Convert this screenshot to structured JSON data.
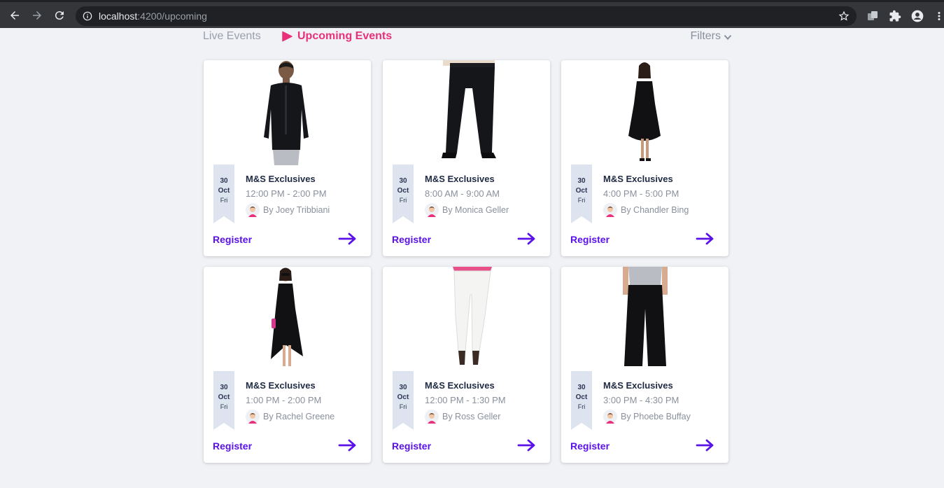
{
  "browser": {
    "url_host": "localhost",
    "url_rest": ":4200/upcoming"
  },
  "tabs": {
    "live": "Live Events",
    "upcoming": "Upcoming Events",
    "filters": "Filters"
  },
  "colors": {
    "accent_pink": "#e8317a",
    "accent_purple": "#5b12e8",
    "ribbon": "#dde3ef"
  },
  "events": [
    {
      "title": "M&S Exclusives",
      "time": "12:00 PM - 2:00 PM",
      "host": "By Joey Tribbiani",
      "day": "30",
      "month": "Oct",
      "weekday": "Fri",
      "register": "Register",
      "image": "man-black-shirt"
    },
    {
      "title": "M&S Exclusives",
      "time": "8:00 AM - 9:00 AM",
      "host": "By Monica Geller",
      "day": "30",
      "month": "Oct",
      "weekday": "Fri",
      "register": "Register",
      "image": "black-trousers"
    },
    {
      "title": "M&S Exclusives",
      "time": "4:00 PM - 5:00 PM",
      "host": "By Chandler Bing",
      "day": "30",
      "month": "Oct",
      "weekday": "Fri",
      "register": "Register",
      "image": "woman-black-dress"
    },
    {
      "title": "M&S Exclusives",
      "time": "1:00 PM - 2:00 PM",
      "host": "By Rachel Greene",
      "day": "30",
      "month": "Oct",
      "weekday": "Fri",
      "register": "Register",
      "image": "woman-high-low-dress"
    },
    {
      "title": "M&S Exclusives",
      "time": "12:00 PM - 1:30 PM",
      "host": "By Ross Geller",
      "day": "30",
      "month": "Oct",
      "weekday": "Fri",
      "register": "Register",
      "image": "white-jeans"
    },
    {
      "title": "M&S Exclusives",
      "time": "3:00 PM - 4:30 PM",
      "host": "By Phoebe Buffay",
      "day": "30",
      "month": "Oct",
      "weekday": "Fri",
      "register": "Register",
      "image": "black-palazzo"
    }
  ]
}
